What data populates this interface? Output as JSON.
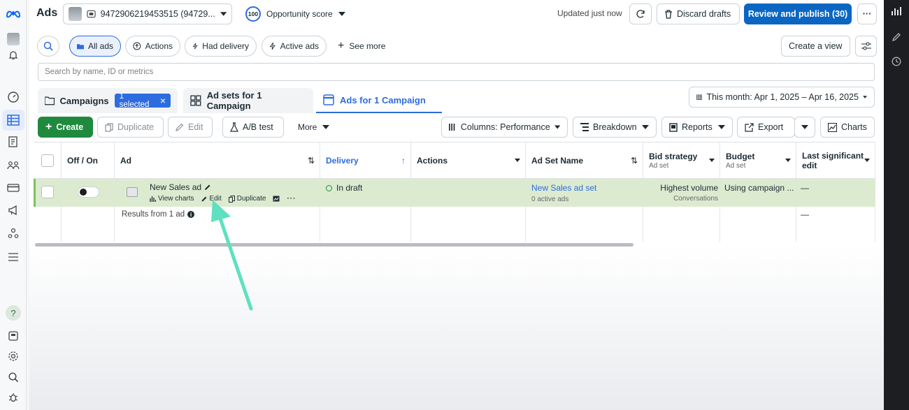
{
  "left_nav": {
    "icons": [
      "meta-logo-icon",
      "account-avatar-icon",
      "notifications-icon",
      "dashboard-icon",
      "ads-manager-table-icon",
      "pages-icon",
      "audiences-icon",
      "billing-icon",
      "campaigns-megaphone-icon",
      "accounts-center-icon",
      "menu-icon",
      "help-icon",
      "business-tools-icon",
      "settings-icon",
      "search-icon",
      "debug-icon"
    ]
  },
  "header": {
    "title": "Ads",
    "account_id": "9472906219453515 (94729...",
    "opportunity_score_value": "100",
    "opportunity_score_label": "Opportunity score",
    "updated_text": "Updated just now",
    "discard_label": "Discard drafts",
    "publish_label": "Review and publish (30)",
    "more_label": "···"
  },
  "filters": {
    "all_ads": "All ads",
    "actions": "Actions",
    "had_delivery": "Had delivery",
    "active_ads": "Active ads",
    "see_more": "See more",
    "create_view": "Create a view"
  },
  "search": {
    "placeholder": "Search by name, ID or metrics"
  },
  "tabs": {
    "campaigns": "Campaigns",
    "selected_badge": "1 selected",
    "adsets": "Ad sets for 1 Campaign",
    "ads": "Ads for 1 Campaign",
    "date_range": "This month: Apr 1, 2025 – Apr 16, 2025"
  },
  "toolbar": {
    "create": "Create",
    "duplicate": "Duplicate",
    "edit": "Edit",
    "ab_test": "A/B test",
    "more": "More",
    "columns": "Columns: Performance",
    "breakdown": "Breakdown",
    "reports": "Reports",
    "export": "Export",
    "charts": "Charts"
  },
  "table": {
    "headers": {
      "off_on": "Off / On",
      "ad": "Ad",
      "delivery": "Delivery",
      "actions": "Actions",
      "ad_set_name": "Ad Set Name",
      "bid_strategy": "Bid strategy",
      "bid_strategy_sub": "Ad set",
      "budget": "Budget",
      "budget_sub": "Ad set",
      "last_edit": "Last significant edit"
    },
    "row": {
      "ad_name": "New Sales ad",
      "view_charts": "View charts",
      "edit": "Edit",
      "duplicate": "Duplicate",
      "delivery": "In draft",
      "ad_set_name": "New Sales ad set",
      "active_ads": "0 active ads",
      "bid_strategy": "Highest volume",
      "bid_strategy_sub": "Conversations",
      "budget": "Using campaign ...",
      "last_edit": "—"
    },
    "summary": {
      "results": "Results from 1 ad",
      "last_edit": "—"
    }
  },
  "colors": {
    "brand_blue": "#2d6cdf",
    "publish_blue": "#0a66c2",
    "create_green": "#1f8a3e",
    "row_highlight": "#dcebd0",
    "annotation_arrow": "#5fe0c0"
  }
}
